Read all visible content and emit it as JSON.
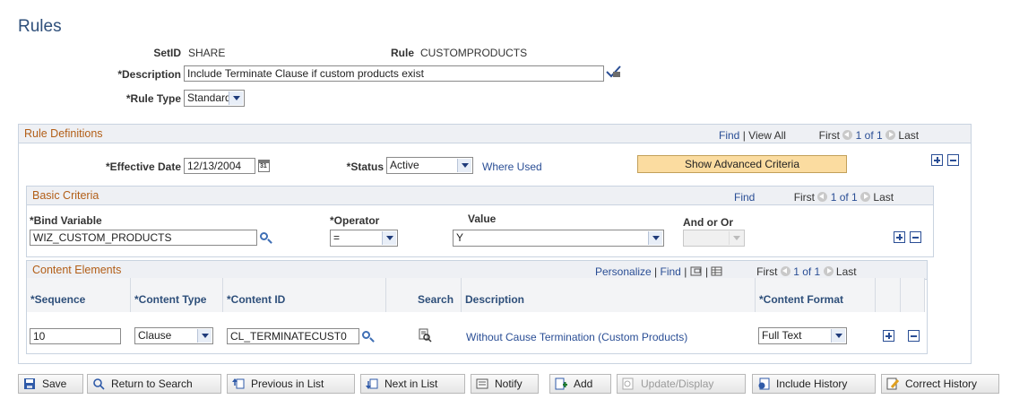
{
  "page": {
    "title": "Rules"
  },
  "header": {
    "setid_label": "SetID",
    "setid_value": "SHARE",
    "rule_label": "Rule",
    "rule_value": "CUSTOMPRODUCTS",
    "description_label": "*Description",
    "description_value": "Include Terminate Clause if custom products exist",
    "ruletype_label": "*Rule Type",
    "ruletype_value": "Standard"
  },
  "rule_defs": {
    "title": "Rule Definitions",
    "find": "Find",
    "sep": "|",
    "view_all": "View All",
    "first": "First",
    "count": "1 of 1",
    "last": "Last",
    "eff_date_label": "*Effective Date",
    "eff_date_value": "12/13/2004",
    "status_label": "*Status",
    "status_value": "Active",
    "where_used": "Where Used",
    "show_adv": "Show Advanced Criteria"
  },
  "basic": {
    "title": "Basic Criteria",
    "find": "Find",
    "first": "First",
    "count": "1 of 1",
    "last": "Last",
    "bind_label": "*Bind Variable",
    "bind_value": "WIZ_CUSTOM_PRODUCTS",
    "operator_label": "*Operator",
    "operator_value": "=",
    "value_label": "Value",
    "value_value": "Y",
    "andor_label": "And or Or",
    "andor_value": ""
  },
  "content": {
    "title": "Content Elements",
    "personalize": "Personalize",
    "sep": "|",
    "find": "Find",
    "first": "First",
    "count": "1 of 1",
    "last": "Last",
    "columns": [
      "*Sequence",
      "*Content Type",
      "*Content ID",
      "Search",
      "Description",
      "*Content Format"
    ],
    "row": {
      "sequence": "10",
      "content_type": "Clause",
      "content_id": "CL_TERMINATECUST0",
      "description": "Without Cause Termination (Custom Products)",
      "content_format": "Full Text"
    }
  },
  "toolbar": {
    "save": "Save",
    "return": "Return to Search",
    "previous": "Previous in List",
    "next": "Next in List",
    "notify": "Notify",
    "add": "Add",
    "update": "Update/Display",
    "include": "Include History",
    "correct": "Correct History"
  }
}
